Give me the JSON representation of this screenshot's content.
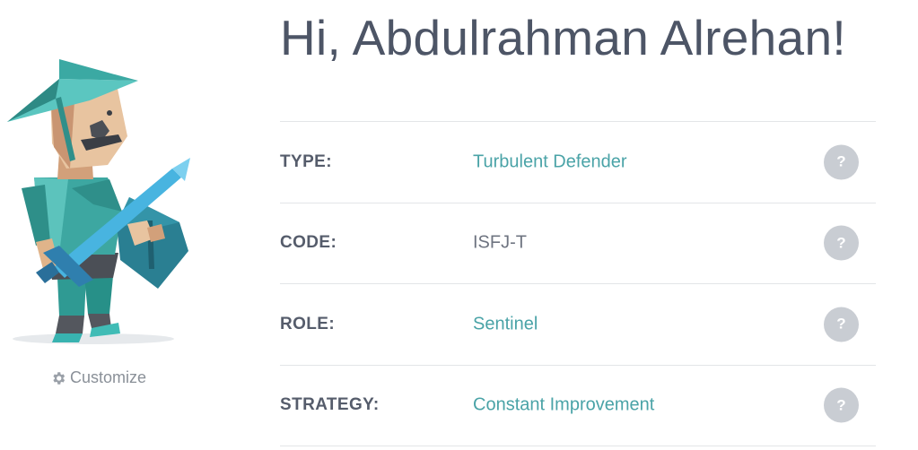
{
  "profile": {
    "greeting": "Hi, Abdulrahman Alrehan!",
    "customize_label": "Customize"
  },
  "traits": [
    {
      "label": "TYPE:",
      "value": "Turbulent Defender",
      "is_link": true,
      "help": "?"
    },
    {
      "label": "CODE:",
      "value": "ISFJ-T",
      "is_link": false,
      "help": "?"
    },
    {
      "label": "ROLE:",
      "value": "Sentinel",
      "is_link": true,
      "help": "?"
    },
    {
      "label": "STRATEGY:",
      "value": "Constant Improvement",
      "is_link": true,
      "help": "?"
    }
  ],
  "icons": {
    "avatar": "defender-character-illustration",
    "customize": "gear-icon",
    "help": "question-mark-icon"
  },
  "colors": {
    "heading": "#4d5566",
    "link": "#4aa3a7",
    "label": "#555c6b",
    "help_bg": "#c9cdd3",
    "divider": "#e3e5e8"
  }
}
